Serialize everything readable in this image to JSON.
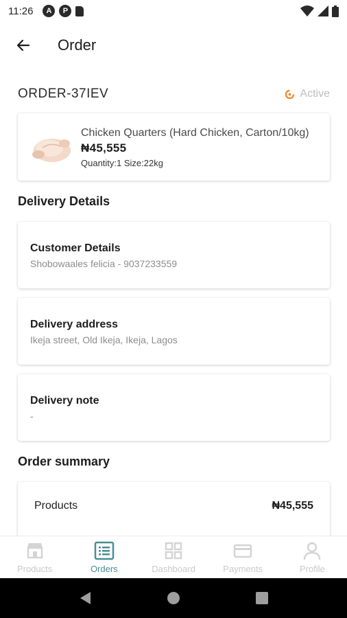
{
  "status_bar": {
    "time": "11:26"
  },
  "app_bar": {
    "title": "Order"
  },
  "order": {
    "id": "ORDER-37IEV",
    "status": "Active",
    "product": {
      "name": "Chicken Quarters (Hard Chicken, Carton/10kg)",
      "price": "₦45,555",
      "meta": "Quantity:1 Size:22kg"
    }
  },
  "delivery": {
    "section_title": "Delivery Details",
    "customer": {
      "label": "Customer Details",
      "value": "Shobowaales felicia - 9037233559"
    },
    "address": {
      "label": "Delivery address",
      "value": "Ikeja street, Old Ikeja, Ikeja, Lagos"
    },
    "note": {
      "label": "Delivery note",
      "value": "-"
    }
  },
  "summary": {
    "section_title": "Order summary",
    "products_label": "Products",
    "products_value": "₦45,555"
  },
  "nav": {
    "items": [
      {
        "label": "Products",
        "icon": "store-icon"
      },
      {
        "label": "Orders",
        "icon": "list-icon"
      },
      {
        "label": "Dashboard",
        "icon": "grid-icon"
      },
      {
        "label": "Payments",
        "icon": "card-icon"
      },
      {
        "label": "Profile",
        "icon": "person-icon"
      }
    ],
    "active": "Orders"
  },
  "colors": {
    "accent": "#4a8d93",
    "status_orange": "#f08a24",
    "inactive": "#c9c9c9"
  }
}
